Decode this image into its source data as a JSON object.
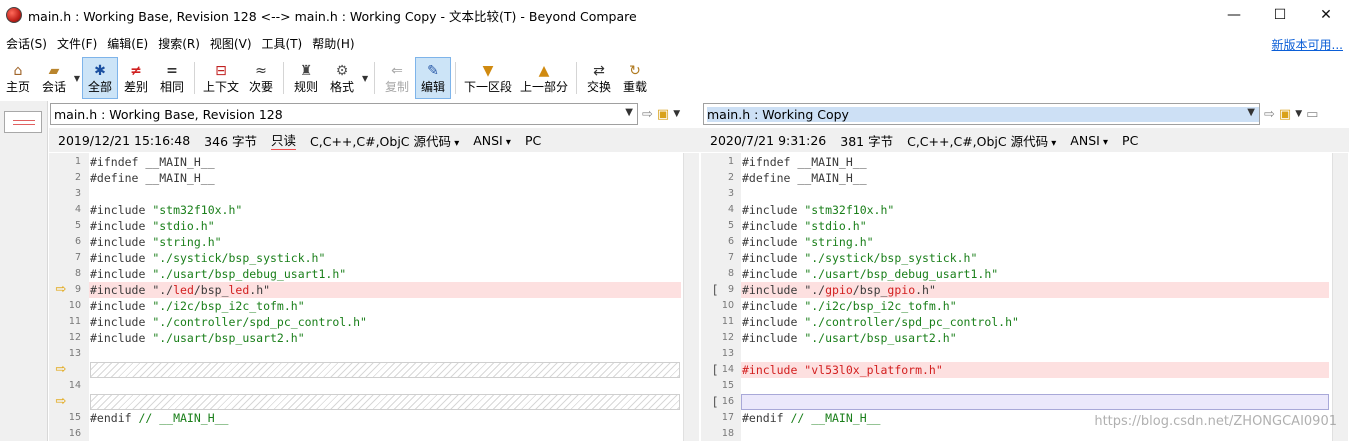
{
  "window": {
    "title": "main.h : Working Base, Revision 128 <--> main.h : Working Copy - 文本比较(T) - Beyond Compare",
    "minimize": "—",
    "maximize": "☐",
    "close": "✕"
  },
  "menu": {
    "items": [
      "会话(S)",
      "文件(F)",
      "编辑(E)",
      "搜索(R)",
      "视图(V)",
      "工具(T)",
      "帮助(H)"
    ],
    "right_link": "新版本可用..."
  },
  "toolbar": {
    "home": "主页",
    "session": "会话",
    "all": "全部",
    "diff": "差别",
    "same": "相同",
    "context": "上下文",
    "minor": "次要",
    "rules": "规则",
    "format": "格式",
    "copy": "复制",
    "edit": "编辑",
    "next": "下一区段",
    "prev": "上一部分",
    "swap": "交换",
    "reload": "重载"
  },
  "left": {
    "path": "main.h : Working Base, Revision 128",
    "date": "2019/12/21 15:16:48",
    "size": "346 字节",
    "readonly": "只读",
    "format": "C,C++,C#,ObjC 源代码",
    "encoding": "ANSI",
    "eol": "PC"
  },
  "right": {
    "path": "main.h : Working Copy",
    "date": "2020/7/21 9:31:26",
    "size": "381 字节",
    "format": "C,C++,C#,ObjC 源代码",
    "encoding": "ANSI",
    "eol": "PC"
  },
  "code": {
    "l1": "#ifndef __MAIN_H__",
    "l2": "#define __MAIN_H__",
    "inc": "#include ",
    "s4": "\"stm32f10x.h\"",
    "s5": "\"stdio.h\"",
    "s6": "\"string.h\"",
    "s7": "\"./systick/bsp_systick.h\"",
    "s8": "\"./usart/bsp_debug_usart1.h\"",
    "s9a": "\"./",
    "s9left": "led",
    "s9mid": "/bsp_",
    "s9leftb": "led",
    "s9end": ".h\"",
    "s9right": "gpio",
    "s9rightb": "gpio",
    "s10": "\"./i2c/bsp_i2c_tofm.h\"",
    "s11": "\"./controller/spd_pc_control.h\"",
    "s12": "\"./usart/bsp_usart2.h\"",
    "s14r": "#include \"vl53l0x_platform.h\"",
    "endif": "#endif ",
    "endif_cmt": "// __MAIN_H__"
  },
  "left_line_numbers": [
    "1",
    "2",
    "3",
    "4",
    "5",
    "6",
    "7",
    "8",
    "9",
    "10",
    "11",
    "12",
    "13",
    "14",
    "15",
    "16"
  ],
  "right_line_numbers": [
    "1",
    "2",
    "3",
    "4",
    "5",
    "6",
    "7",
    "8",
    "9",
    "10",
    "11",
    "12",
    "13",
    "14",
    "15",
    "16",
    "17",
    "18"
  ],
  "watermark": "https://blog.csdn.net/ZHONGCAI0901"
}
